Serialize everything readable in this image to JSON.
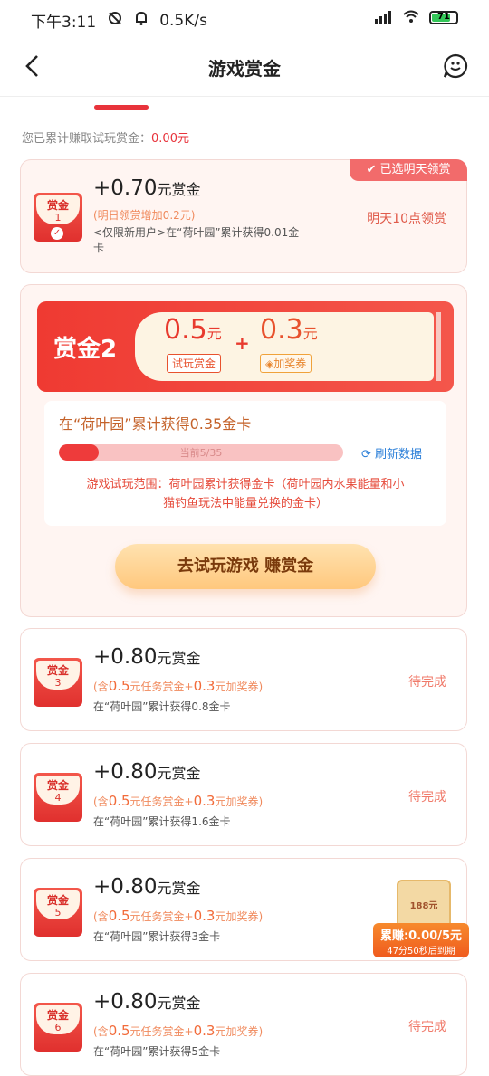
{
  "statusbar": {
    "time": "下午3:11",
    "speed": "0.5K/s",
    "battery": "71"
  },
  "nav": {
    "title": "游戏赏金"
  },
  "summary": {
    "label": "您已累计赚取试玩赏金：",
    "amount": "0.00元"
  },
  "reward1": {
    "tag": "已选明天领赏",
    "badge_label": "赏金",
    "badge_num": "1",
    "amount_prefix": "+0.70",
    "amount_unit": "元赏金",
    "subline": "(明日领赏增加0.2元)",
    "desc_line1": "<仅限新用户>在“荷叶园”累计获得0.01金",
    "desc_line2": "卡",
    "status": "明天10点领赏"
  },
  "reward2": {
    "name": "赏金2",
    "cash": "0.5",
    "cash_unit": "元",
    "cash_label": "试玩赏金",
    "plus": "+",
    "coupon": "0.3",
    "coupon_unit": "元",
    "coupon_label": "加奖券",
    "goal": "在“荷叶园”累计获得0.35金卡",
    "progress_text": "当前5/35",
    "progress_value": 0.14,
    "refresh": "刷新数据",
    "range_line1": "游戏试玩范围：荷叶园累计获得金卡（荷叶园内水果能量和小",
    "range_line2": "猫钓鱼玩法中能量兑换的金卡）",
    "cta": "去试玩游戏 赚赏金"
  },
  "rewards": [
    {
      "badge_label": "赏金",
      "badge_num": "3",
      "amount_prefix": "+0.80",
      "amount_unit": "元赏金",
      "sub_a": "(含",
      "sub_b": "0.5",
      "sub_c": "元任务赏金+",
      "sub_d": "0.3",
      "sub_e": "元加奖券)",
      "desc": "在“荷叶园”累计获得0.8金卡",
      "status": "待完成"
    },
    {
      "badge_label": "赏金",
      "badge_num": "4",
      "amount_prefix": "+0.80",
      "amount_unit": "元赏金",
      "sub_a": "(含",
      "sub_b": "0.5",
      "sub_c": "元任务赏金+",
      "sub_d": "0.3",
      "sub_e": "元加奖券)",
      "desc": "在“荷叶园”累计获得1.6金卡",
      "status": "待完成"
    },
    {
      "badge_label": "赏金",
      "badge_num": "5",
      "amount_prefix": "+0.80",
      "amount_unit": "元赏金",
      "sub_a": "(含",
      "sub_b": "0.5",
      "sub_c": "元任务赏金+",
      "sub_d": "0.3",
      "sub_e": "元加奖券)",
      "desc": "在“荷叶园”累计获得3金卡",
      "status": ""
    },
    {
      "badge_label": "赏金",
      "badge_num": "6",
      "amount_prefix": "+0.80",
      "amount_unit": "元赏金",
      "sub_a": "(含",
      "sub_b": "0.5",
      "sub_c": "元任务赏金+",
      "sub_d": "0.3",
      "sub_e": "元加奖券)",
      "desc": "在“荷叶园”累计获得5金卡",
      "status": "待完成"
    }
  ],
  "promo": {
    "ticket_value": "188元",
    "line1": "累赚:0.00/5元",
    "line2": "47分50秒后到期"
  }
}
